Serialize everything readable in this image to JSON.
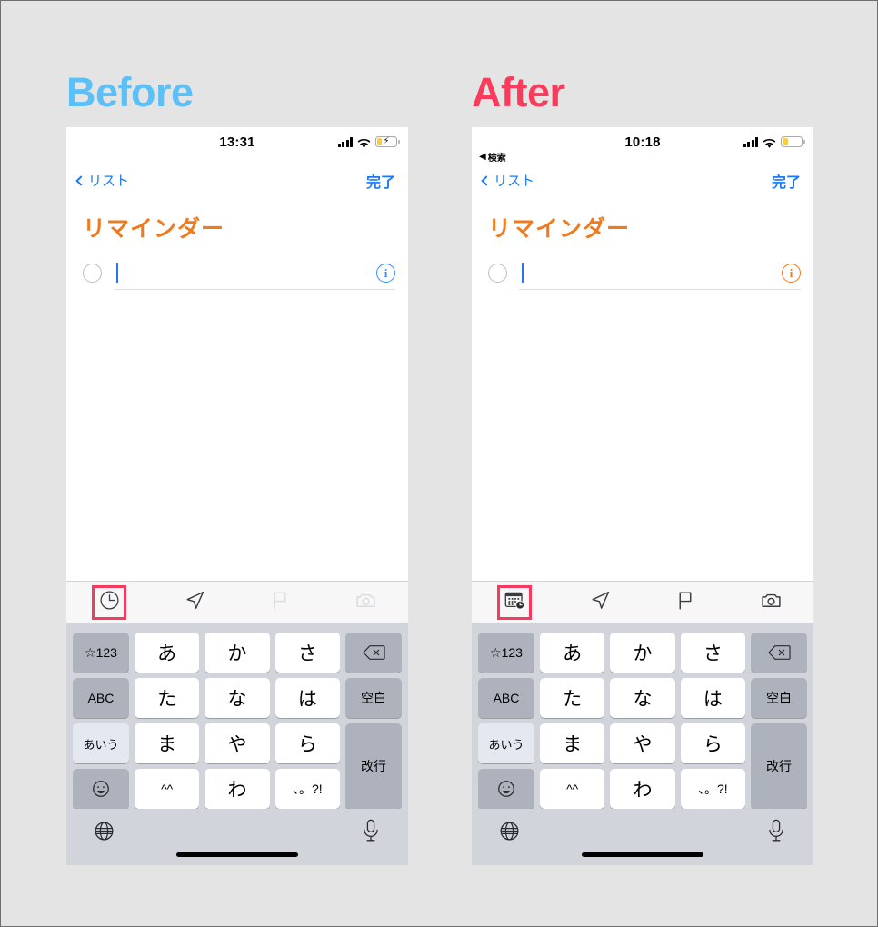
{
  "page": {
    "background_color": "#e4e4e4",
    "comparison_type": "before-after"
  },
  "panels": [
    {
      "id": "before",
      "title": "Before",
      "title_color": "#5bc0f8",
      "status_bar": {
        "time": "13:31",
        "back_to_app": "",
        "back_arrow": "",
        "signal_label": "signal-bars",
        "wifi_label": "wifi-icon",
        "battery": {
          "level_percent": 22,
          "charging": true,
          "bolt_glyph": "⚡",
          "color": "#f7cd46"
        }
      },
      "nav_bar": {
        "back_label": "リスト",
        "done_label": "完了",
        "accent_color": "#1a7af8"
      },
      "list_title": "リマインダー",
      "list_title_color": "#f07a1e",
      "task_row": {
        "checkbox_state": "unchecked",
        "text_value": "",
        "caret_visible": true,
        "info_glyph": "i",
        "info_color": "#3b8bf5"
      },
      "accessory_bar": {
        "items": [
          {
            "icon": "clock-icon",
            "label": "時刻",
            "enabled": true,
            "highlighted": true
          },
          {
            "icon": "location-arrow-icon",
            "label": "場所",
            "enabled": true,
            "highlighted": false
          },
          {
            "icon": "flag-icon",
            "label": "フラグ",
            "enabled": false,
            "highlighted": false
          },
          {
            "icon": "camera-icon",
            "label": "カメラ",
            "enabled": false,
            "highlighted": false
          }
        ],
        "highlight_color": "#f43a5e"
      }
    },
    {
      "id": "after",
      "title": "After",
      "title_color": "#f93b5c",
      "status_bar": {
        "time": "10:18",
        "back_to_app": "検索",
        "back_arrow": "◀",
        "signal_label": "signal-bars",
        "wifi_label": "wifi-icon",
        "battery": {
          "level_percent": 25,
          "charging": false,
          "bolt_glyph": "",
          "color": "#f7cd46"
        }
      },
      "nav_bar": {
        "back_label": "リスト",
        "done_label": "完了",
        "accent_color": "#1a7af8"
      },
      "list_title": "リマインダー",
      "list_title_color": "#f07a1e",
      "task_row": {
        "checkbox_state": "unchecked",
        "text_value": "",
        "caret_visible": true,
        "info_glyph": "i",
        "info_color": "#f4761f"
      },
      "accessory_bar": {
        "items": [
          {
            "icon": "calendar-clock-icon",
            "label": "日時",
            "enabled": true,
            "highlighted": true
          },
          {
            "icon": "location-arrow-icon",
            "label": "場所",
            "enabled": true,
            "highlighted": false
          },
          {
            "icon": "flag-icon",
            "label": "フラグ",
            "enabled": true,
            "highlighted": false
          },
          {
            "icon": "camera-icon",
            "label": "カメラ",
            "enabled": true,
            "highlighted": false
          }
        ],
        "highlight_color": "#f43a5e"
      }
    }
  ],
  "keyboard": {
    "layout_name": "japanese-kana",
    "rows": [
      [
        "☆123",
        "あ",
        "か",
        "さ",
        "⌫"
      ],
      [
        "ABC",
        "た",
        "な",
        "は",
        "空白"
      ],
      [
        "あいう",
        "ま",
        "や",
        "ら",
        "改行"
      ],
      [
        "☺",
        "^^",
        "わ",
        "、。?!",
        ""
      ]
    ],
    "keys": {
      "symbols": "☆123",
      "abc": "ABC",
      "kana": "あいう",
      "emoji": "☺",
      "delete": "⌫",
      "space": "空白",
      "enter": "改行",
      "a": "あ",
      "ka": "か",
      "sa": "さ",
      "ta": "た",
      "na": "な",
      "ha": "は",
      "ma": "ま",
      "ya": "や",
      "ra": "ら",
      "kaomoji": "^^",
      "wa": "わ",
      "punct": "、。?!"
    },
    "bottom_bar": {
      "globe_icon": "globe-icon",
      "mic_icon": "microphone-icon",
      "home_indicator": "home-indicator"
    }
  }
}
